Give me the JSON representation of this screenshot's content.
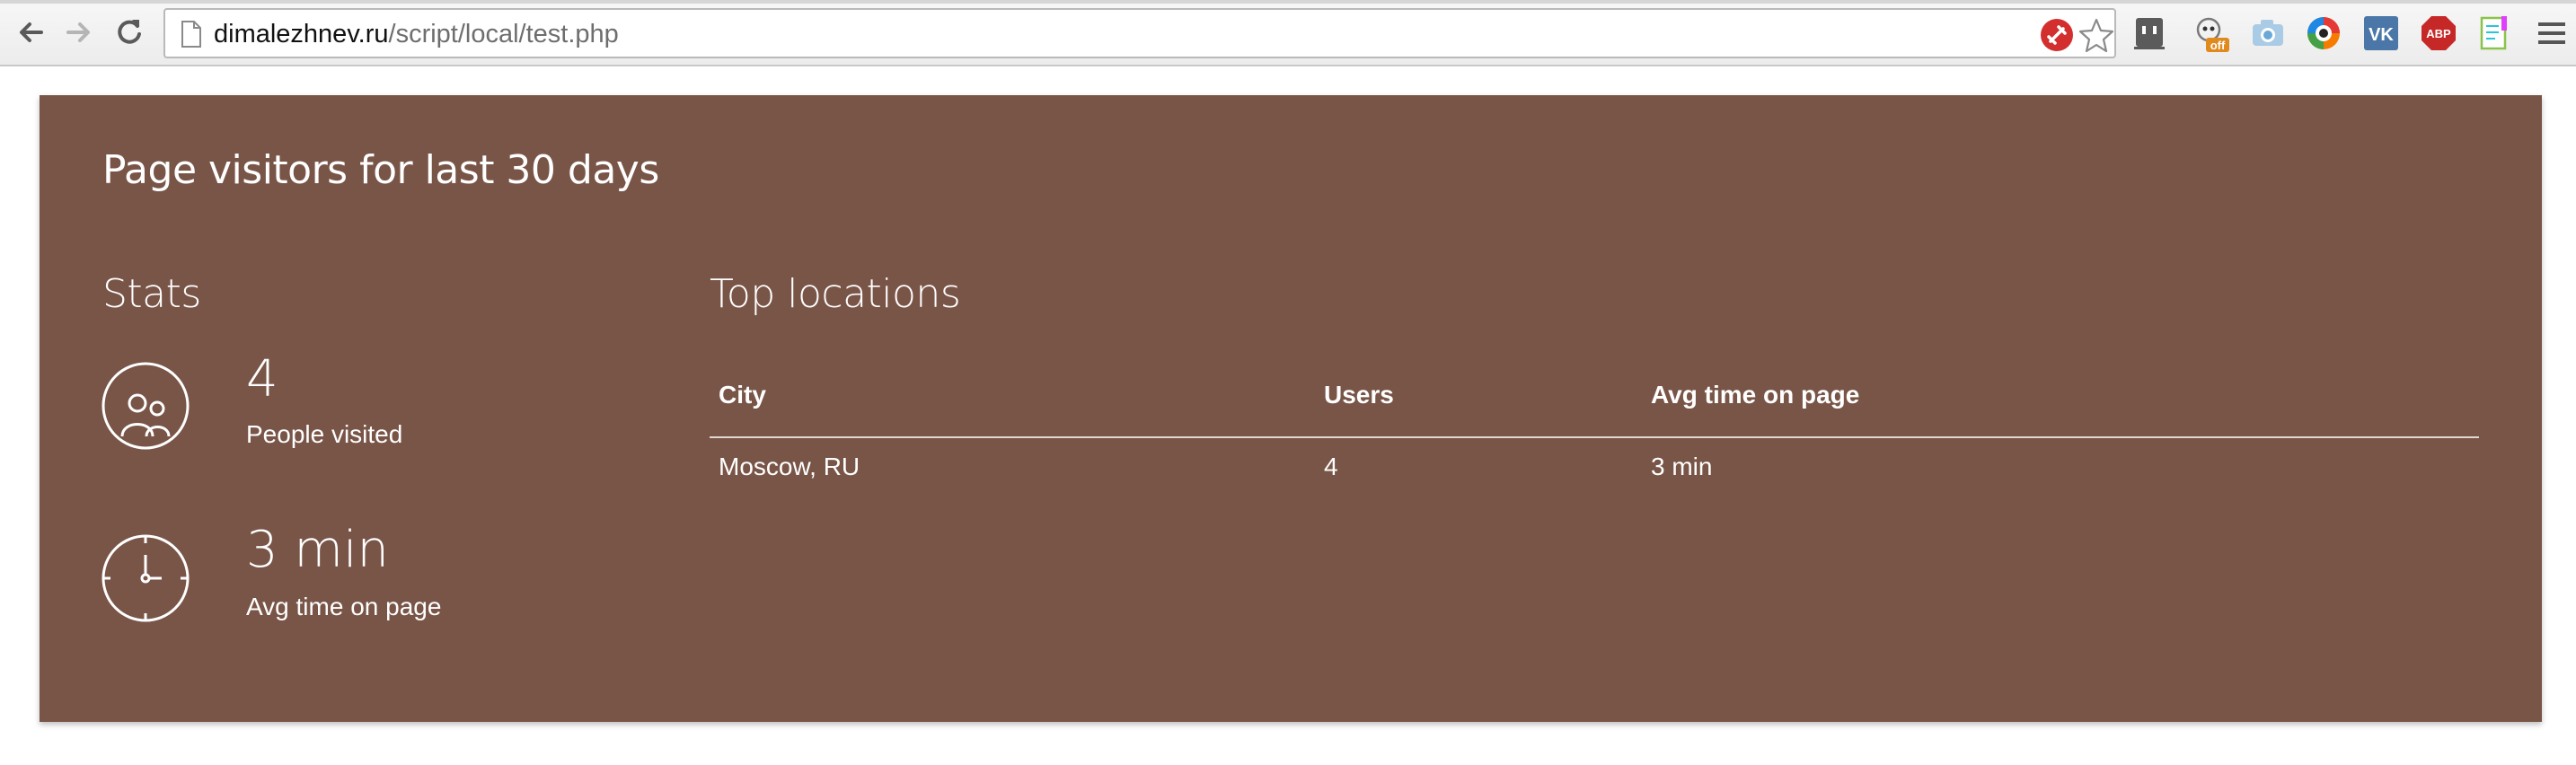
{
  "browser": {
    "url_host": "dimalezhnev.ru",
    "url_path": "/script/local/test.php",
    "extensions": [
      {
        "name": "lastpass-icon",
        "color": "#d32f2f"
      },
      {
        "name": "bookmark-star-icon",
        "color": "#888888"
      },
      {
        "name": "face-ext-icon",
        "color": "#444444"
      },
      {
        "name": "ghost-off-icon",
        "badge": "off",
        "color": "#e08a1e"
      },
      {
        "name": "camera-icon",
        "color": "#6aa8d8"
      },
      {
        "name": "color-eye-icon",
        "color": "#e53935"
      },
      {
        "name": "vk-icon",
        "label": "VK",
        "color": "#4a76a8"
      },
      {
        "name": "adblock-icon",
        "label": "ABP",
        "color": "#c62828"
      },
      {
        "name": "note-icon",
        "color": "#8bc34a"
      },
      {
        "name": "menu-icon",
        "color": "#555555"
      }
    ]
  },
  "page": {
    "title": "Page visitors for last 30 days",
    "accent_color": "#795548",
    "stats": {
      "heading": "Stats",
      "items": [
        {
          "icon": "people-icon",
          "value": "4",
          "label": "People visited"
        },
        {
          "icon": "clock-icon",
          "value": "3 min",
          "label": "Avg time on page"
        }
      ]
    },
    "locations": {
      "heading": "Top locations",
      "columns": [
        "City",
        "Users",
        "Avg time on page"
      ],
      "rows": [
        [
          "Moscow, RU",
          "4",
          "3 min"
        ]
      ]
    }
  }
}
